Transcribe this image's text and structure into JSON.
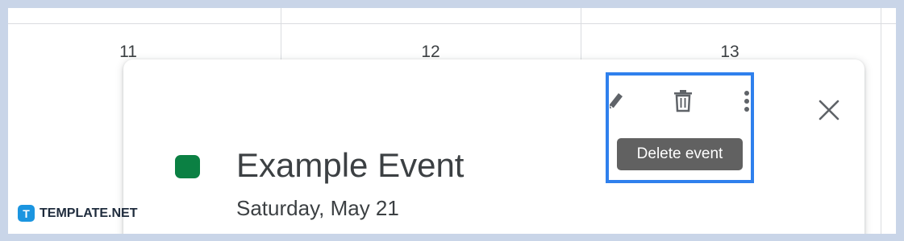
{
  "calendar": {
    "days": [
      "11",
      "12",
      "13"
    ]
  },
  "event_card": {
    "color": "#0b8043",
    "title": "Example Event",
    "date": "Saturday, May 21",
    "toolbar": {
      "edit_icon": "pencil-icon",
      "delete_icon": "trash-icon",
      "more_icon": "more-vert-icon",
      "close_icon": "close-icon"
    },
    "tooltip": "Delete event",
    "highlight_color": "#2f80ed"
  },
  "brand": {
    "mark": "T",
    "name": "TEMPLATE.NET"
  }
}
